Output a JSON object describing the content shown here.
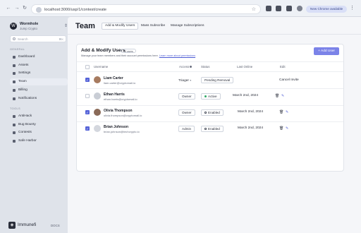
{
  "browser": {
    "url": "localhost:3000/usp/1/contest/create",
    "update_label": "New Chrome available"
  },
  "sidebar": {
    "org_name": "Wormhole",
    "org_sub": "Jump Crypto",
    "search_placeholder": "Search",
    "search_shortcut": "⌘K",
    "general_label": "GENERAL",
    "tools_label": "TOOLS",
    "general_items": [
      {
        "label": "Dashboard"
      },
      {
        "label": "Assets"
      },
      {
        "label": "Settings"
      },
      {
        "label": "Team"
      },
      {
        "label": "Billing"
      },
      {
        "label": "Notifications"
      }
    ],
    "tool_items": [
      {
        "label": "AntiHack"
      },
      {
        "label": "Bug Bounty"
      },
      {
        "label": "Contests"
      },
      {
        "label": "Safe Harbor"
      }
    ],
    "brand": "Immunefi",
    "docs": "DOCS"
  },
  "main": {
    "title": "Team",
    "tabs": [
      {
        "label": "Add & Modify Users"
      },
      {
        "label": "Mass Subscribe"
      },
      {
        "label": "Manage Subscriptions"
      }
    ]
  },
  "card": {
    "title": "Add & Modify Users",
    "count": "14 users",
    "description": "Manage your team members and their account permissions here.",
    "learn_more": "Learn more about permissions",
    "add_button": "+ Add User",
    "columns": {
      "username": "Username",
      "access": "Access",
      "status": "Status",
      "last_online": "Last Online",
      "edit": "Edit"
    },
    "rows": [
      {
        "name": "Liam Carter",
        "email": "liam.carter@cryptomail.io",
        "access": "Triager",
        "status": "Pending Removal",
        "last_online": "",
        "edit": "Cancel Invite"
      },
      {
        "name": "Ethan Harris",
        "email": "ethan.harris@cryptomail.io",
        "access": "Owner",
        "status": "Active",
        "last_online": "March 2nd, 2024",
        "edit": ""
      },
      {
        "name": "Olivia Thompson",
        "email": "olivia.thompson@cryptomail.io",
        "access": "Owner",
        "status": "Enabled",
        "last_online": "March 2nd, 2024",
        "edit": ""
      },
      {
        "name": "Brian Johnson",
        "email": "brian.johnson@techcrypto.io",
        "access": "Admin",
        "status": "Enabled",
        "last_online": "March 2nd, 2024",
        "edit": ""
      }
    ]
  }
}
